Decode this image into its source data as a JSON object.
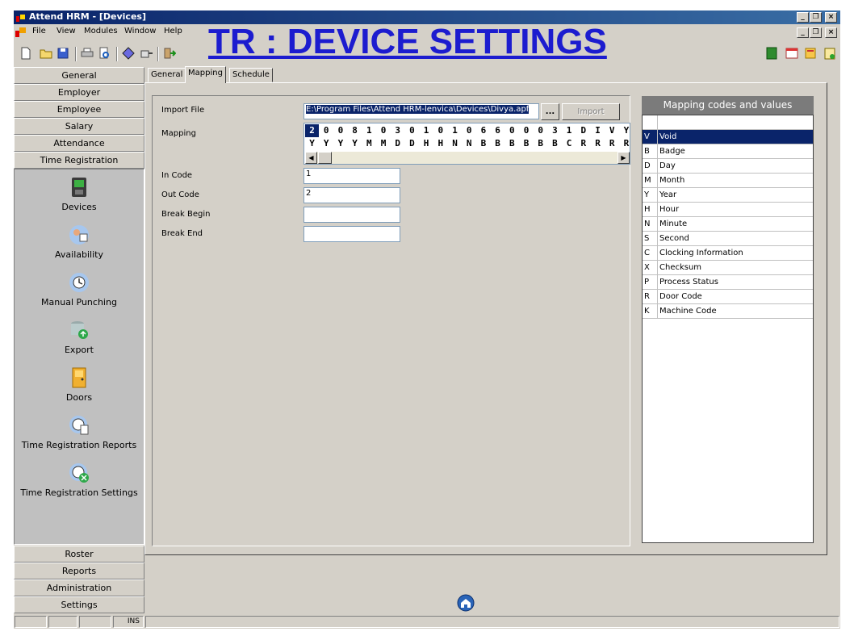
{
  "window": {
    "title": "Attend HRM - [Devices]",
    "controls": {
      "minimize": "_",
      "restore": "4",
      "close": "×"
    }
  },
  "menu": [
    "File",
    "View",
    "Modules",
    "Window",
    "Help"
  ],
  "headline": "TR : DEVICE SETTINGS",
  "sidebar": {
    "top_groups": [
      "General",
      "Employer",
      "Employee",
      "Salary",
      "Attendance",
      "Time Registration"
    ],
    "items": [
      {
        "label": "Devices",
        "icon": "device-terminal-icon"
      },
      {
        "label": "Availability",
        "icon": "availability-icon"
      },
      {
        "label": "Manual Punching",
        "icon": "manual-punching-icon"
      },
      {
        "label": "Export",
        "icon": "export-database-icon"
      },
      {
        "label": "Doors",
        "icon": "door-icon"
      },
      {
        "label": "Time Registration Reports",
        "icon": "report-clock-icon"
      },
      {
        "label": "Time Registration Settings",
        "icon": "settings-clock-icon"
      }
    ],
    "bottom_groups": [
      "Roster",
      "Reports",
      "Administration",
      "Settings"
    ]
  },
  "tabs": [
    {
      "label": "General",
      "active": false
    },
    {
      "label": "Mapping",
      "active": true
    },
    {
      "label": "Schedule",
      "active": false
    }
  ],
  "form": {
    "import_file_label": "Import File",
    "import_file_value": "E:\\Program Files\\Attend HRM-lenvica\\Devices\\Divya.apf",
    "browse_label": "...",
    "import_button_label": "Import",
    "mapping_label": "Mapping",
    "mapping_row1": [
      "2",
      "0",
      "0",
      "8",
      "1",
      "0",
      "3",
      "0",
      "1",
      "0",
      "1",
      "0",
      "6",
      "6",
      "0",
      "0",
      "0",
      "3",
      "1",
      "D",
      "I",
      "V",
      "Y"
    ],
    "mapping_row2": [
      "Y",
      "Y",
      "Y",
      "Y",
      "M",
      "M",
      "D",
      "D",
      "H",
      "H",
      "N",
      "N",
      "B",
      "B",
      "B",
      "B",
      "B",
      "B",
      "C",
      "R",
      "R",
      "R",
      "R"
    ],
    "in_code_label": "In Code",
    "in_code_value": "1",
    "out_code_label": "Out Code",
    "out_code_value": "2",
    "break_begin_label": "Break Begin",
    "break_begin_value": "",
    "break_end_label": "Break End",
    "break_end_value": ""
  },
  "codes": {
    "header": "Mapping codes and values",
    "rows": [
      {
        "code": "V",
        "value": "Void",
        "selected": true
      },
      {
        "code": "B",
        "value": "Badge"
      },
      {
        "code": "D",
        "value": "Day"
      },
      {
        "code": "M",
        "value": "Month"
      },
      {
        "code": "Y",
        "value": "Year"
      },
      {
        "code": "H",
        "value": "Hour"
      },
      {
        "code": "N",
        "value": "Minute"
      },
      {
        "code": "S",
        "value": "Second"
      },
      {
        "code": "C",
        "value": "Clocking Information"
      },
      {
        "code": "X",
        "value": "Checksum"
      },
      {
        "code": "P",
        "value": "Process Status"
      },
      {
        "code": "R",
        "value": "Door Code"
      },
      {
        "code": "K",
        "value": "Machine Code"
      }
    ]
  },
  "statusbar": {
    "ins": "INS"
  },
  "colors": {
    "title_bar": "#0a246a",
    "headline": "#1c1ccf",
    "selection": "#0a246a",
    "face": "#d4d0c8"
  }
}
